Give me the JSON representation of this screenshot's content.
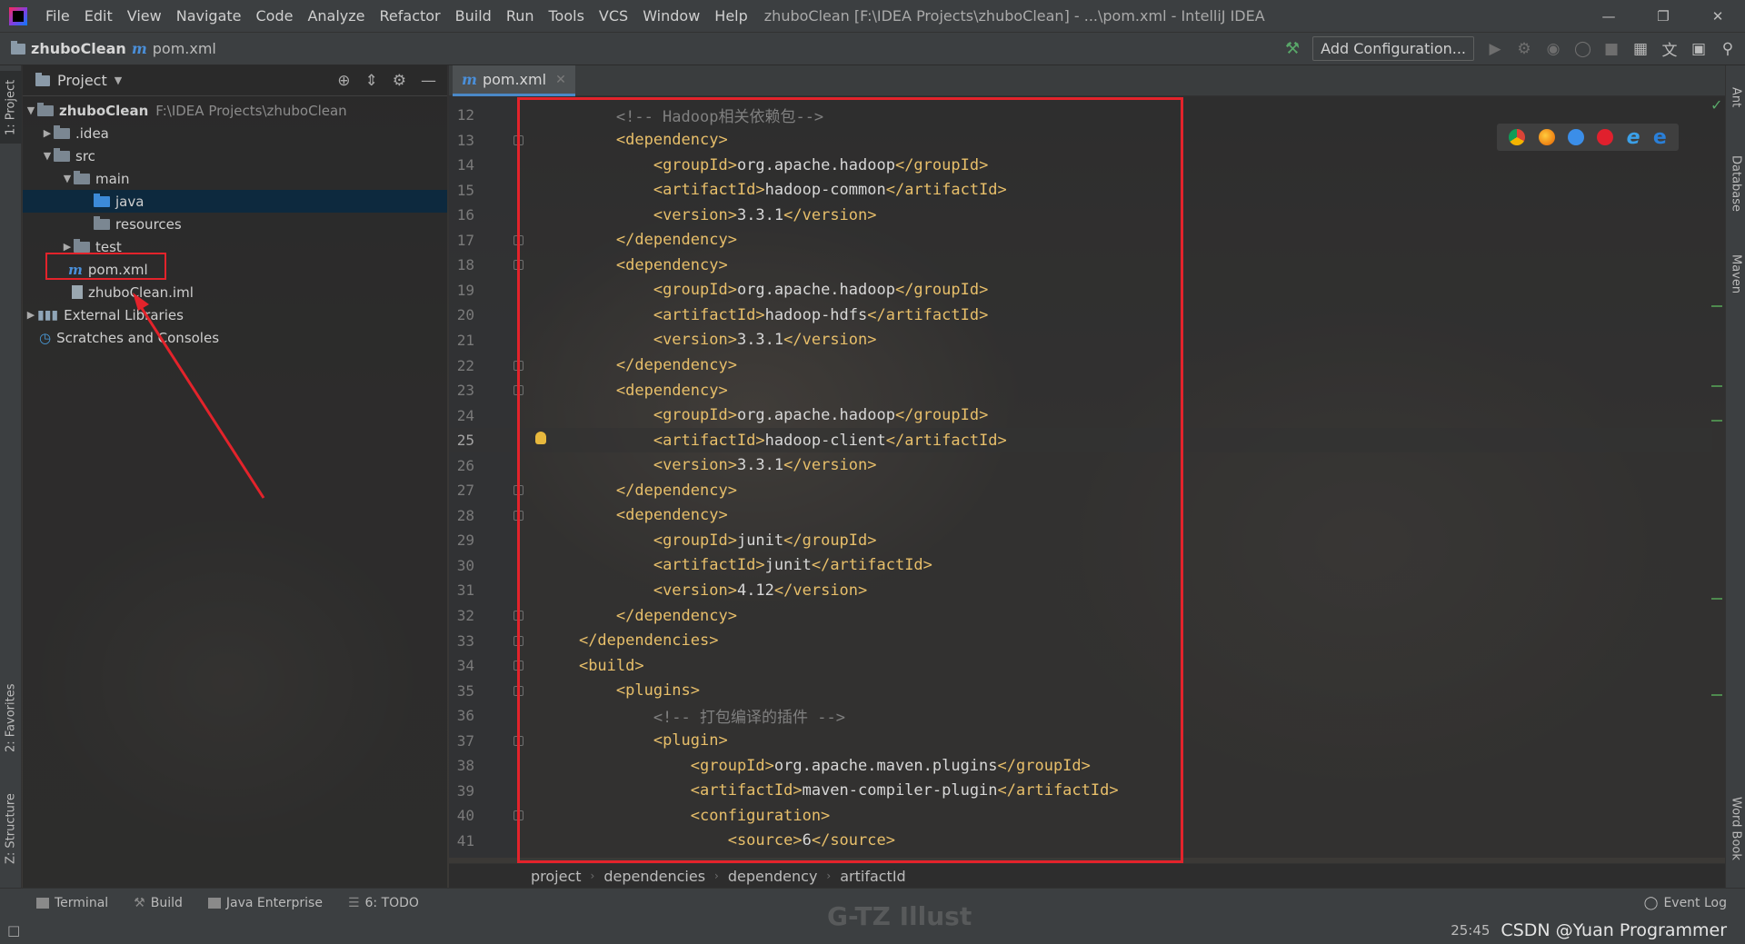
{
  "menu": [
    "File",
    "Edit",
    "View",
    "Navigate",
    "Code",
    "Analyze",
    "Refactor",
    "Build",
    "Run",
    "Tools",
    "VCS",
    "Window",
    "Help"
  ],
  "window_title": "zhuboClean [F:\\IDEA Projects\\zhuboClean] - ...\\pom.xml - IntelliJ IDEA",
  "nav": {
    "project": "zhuboClean",
    "file": "pom.xml",
    "add_config": "Add Configuration..."
  },
  "left_tabs": {
    "project": "1: Project",
    "favorites": "2: Favorites",
    "structure": "Z: Structure"
  },
  "right_tabs": {
    "ant": "Ant",
    "database": "Database",
    "maven": "Maven",
    "wordbook": "Word Book"
  },
  "project_panel": {
    "title": "Project",
    "tree": [
      {
        "label": "zhuboClean",
        "path": "F:\\IDEA Projects\\zhuboClean"
      },
      {
        "label": ".idea"
      },
      {
        "label": "src"
      },
      {
        "label": "main"
      },
      {
        "label": "java"
      },
      {
        "label": "resources"
      },
      {
        "label": "test"
      },
      {
        "label": "pom.xml"
      },
      {
        "label": "zhuboClean.iml"
      },
      {
        "label": "External Libraries"
      },
      {
        "label": "Scratches and Consoles"
      }
    ]
  },
  "editor": {
    "tab": "pom.xml",
    "lines": [
      {
        "n": "12",
        "text": "        <!-- Hadoop相关依赖包-->"
      },
      {
        "n": "13",
        "text": "        <dependency>"
      },
      {
        "n": "14",
        "text": "            <groupId>org.apache.hadoop</groupId>"
      },
      {
        "n": "15",
        "text": "            <artifactId>hadoop-common</artifactId>"
      },
      {
        "n": "16",
        "text": "            <version>3.3.1</version>"
      },
      {
        "n": "17",
        "text": "        </dependency>"
      },
      {
        "n": "18",
        "text": "        <dependency>"
      },
      {
        "n": "19",
        "text": "            <groupId>org.apache.hadoop</groupId>"
      },
      {
        "n": "20",
        "text": "            <artifactId>hadoop-hdfs</artifactId>"
      },
      {
        "n": "21",
        "text": "            <version>3.3.1</version>"
      },
      {
        "n": "22",
        "text": "        </dependency>"
      },
      {
        "n": "23",
        "text": "        <dependency>"
      },
      {
        "n": "24",
        "text": "            <groupId>org.apache.hadoop</groupId>"
      },
      {
        "n": "25",
        "text": "            <artifactId>hadoop-client</artifactId>"
      },
      {
        "n": "26",
        "text": "            <version>3.3.1</version>"
      },
      {
        "n": "27",
        "text": "        </dependency>"
      },
      {
        "n": "28",
        "text": "        <dependency>"
      },
      {
        "n": "29",
        "text": "            <groupId>junit</groupId>"
      },
      {
        "n": "30",
        "text": "            <artifactId>junit</artifactId>"
      },
      {
        "n": "31",
        "text": "            <version>4.12</version>"
      },
      {
        "n": "32",
        "text": "        </dependency>"
      },
      {
        "n": "33",
        "text": "    </dependencies>"
      },
      {
        "n": "34",
        "text": "    <build>"
      },
      {
        "n": "35",
        "text": "        <plugins>"
      },
      {
        "n": "36",
        "text": "            <!-- 打包编译的插件 -->"
      },
      {
        "n": "37",
        "text": "            <plugin>"
      },
      {
        "n": "38",
        "text": "                <groupId>org.apache.maven.plugins</groupId>"
      },
      {
        "n": "39",
        "text": "                <artifactId>maven-compiler-plugin</artifactId>"
      },
      {
        "n": "40",
        "text": "                <configuration>"
      },
      {
        "n": "41",
        "text": "                    <source>6</source>"
      }
    ],
    "current_line": "25"
  },
  "breadcrumbs": [
    "project",
    "dependencies",
    "dependency",
    "artifactId"
  ],
  "bottom_tools": [
    "Terminal",
    "Build",
    "Java Enterprise",
    "6: TODO"
  ],
  "event_log": "Event Log",
  "status": {
    "position": "25:45",
    "watermark": "CSDN @Yuan Programmer"
  },
  "center_watermark": "G-TZ Illust"
}
